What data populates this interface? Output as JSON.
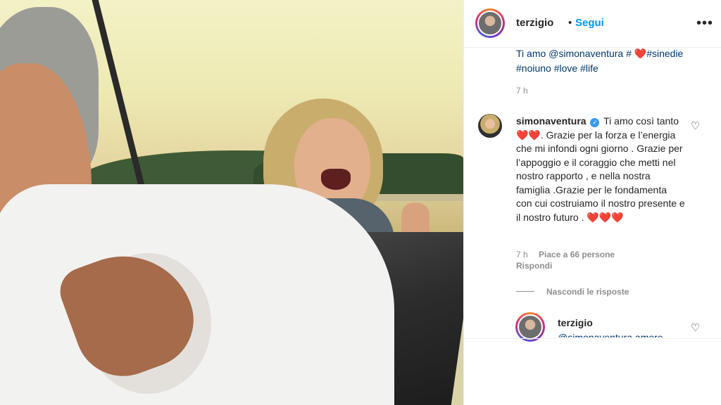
{
  "post": {
    "username": "terzigio",
    "dot": "•",
    "follow_label": "Segui",
    "more_icon": "more-horizontal-icon",
    "caption_visible_line1": "Ti amo @simonaventura # ❤️#sinedie",
    "caption_visible_line2": "#noiuno #love #life",
    "caption_time": "7 h"
  },
  "comment": {
    "username": "simonaventura",
    "verified_icon": "verified-badge-icon",
    "text_part1": "Ti amo così tanto",
    "text_hearts1": "❤️❤️",
    "text_part2": ". Grazie per la forza e l’energia che mi infondi ogni giorno . Grazie per l’appoggio e il coraggio che metti nel nostro rapporto , e nella nostra famiglia .Grazie per le fondamenta con cui costruiamo il nostro presente e il nostro futuro .",
    "text_hearts2": "❤️❤️❤️",
    "time": "7 h",
    "likes": "Piace a 66 persone",
    "reply_label": "Rispondi",
    "hide_replies_label": "Nascondi le risposte"
  },
  "reply": {
    "username": "terzigio",
    "snippet": "@simonaventura amore"
  },
  "colors": {
    "link": "#00376b",
    "follow": "#0095f6",
    "verified": "#3897f0",
    "muted": "#8e8e8e"
  }
}
